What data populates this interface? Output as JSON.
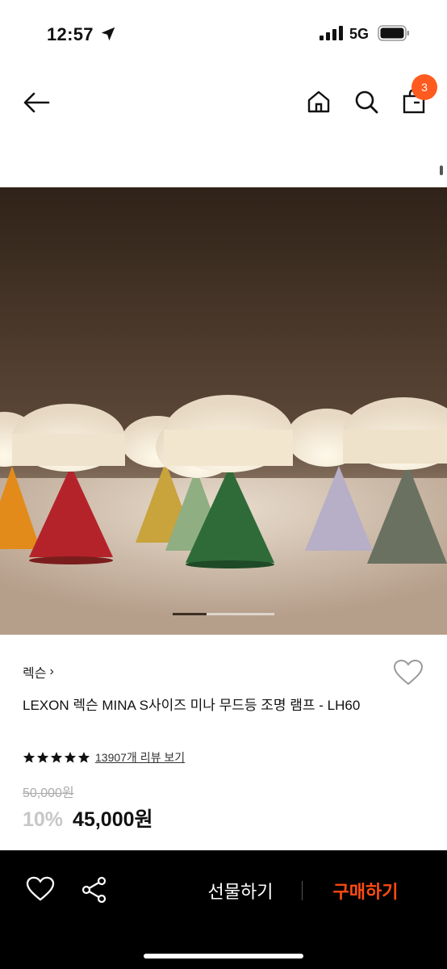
{
  "status": {
    "time": "12:57",
    "network": "5G"
  },
  "nav": {
    "cart_count": "3"
  },
  "product": {
    "brand": "렉슨",
    "brand_chevron": "›",
    "title": "LEXON 렉슨 MINA S사이즈 미나 무드등 조명 램프 - LH60",
    "rating": 5,
    "review_text": "13907개 리뷰 보기",
    "original_price": "50,000원",
    "discount": "10%",
    "sale_price": "45,000원"
  },
  "carousel": {
    "active_index": 0,
    "count": 3
  },
  "bottom_bar": {
    "gift_label": "선물하기",
    "buy_label": "구매하기"
  },
  "colors": {
    "accent": "#ff5a1f",
    "buy": "#ff4b12",
    "bar_bg": "#000000"
  }
}
